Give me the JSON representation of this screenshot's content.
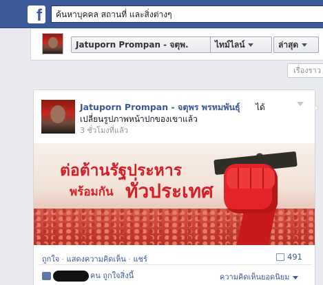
{
  "header": {
    "logo": "f",
    "search_placeholder": "ค้นหาบุคคล สถานที่ และสิ่งต่างๆ"
  },
  "profile_bar": {
    "name_button": "Jatuporn Prompan - จตุพ.",
    "timeline_button": "ไทม์ไลน์",
    "latest_button": "ล่าสุด"
  },
  "stories_tab": "เรื่องราว",
  "post": {
    "author": "Jatuporn Prompan - จตุพร พรหมพันธุ์",
    "verb": "ได้",
    "action": "เปลี่ยนรูปภาพหน้าปกของเขาแล้ว",
    "time": "3 ชั่วโมงที่แล้ว",
    "cover": {
      "line1": "ต่อต้านรัฐประหาร",
      "line2_small": "พร้อมกัน",
      "line2_big": "ทั่วประเทศ"
    },
    "actions": {
      "like": "ถูกใจ",
      "comment": "แสดงความคิดเห็น",
      "share": "แชร์",
      "separator": "·"
    },
    "comment_count": "491",
    "likes_text": "คน ถูกใจสิ่งนี้",
    "popular_comments": "ความคิดเห็นยอดนิยม"
  },
  "icons": {
    "logo": "facebook-logo",
    "caret": "chevron-down-icon",
    "comment": "comment-icon",
    "like": "thumbs-up-icon"
  },
  "colors": {
    "brand": "#3b5998",
    "link": "#3b5998",
    "poster_red": "#d5202a"
  }
}
